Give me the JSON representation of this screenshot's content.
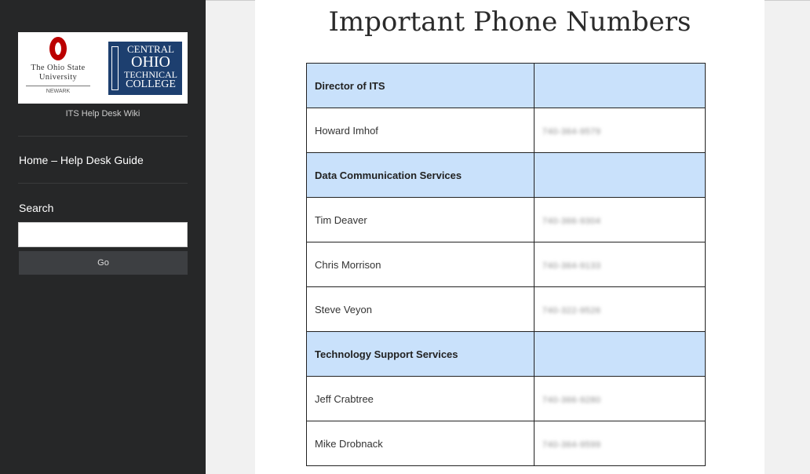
{
  "sidebar": {
    "logo": {
      "osu_name": "The Ohio State University",
      "osu_campus": "NEWARK",
      "cotc_lines": [
        "CENTRAL",
        "OHIO",
        "TECHNICAL",
        "COLLEGE"
      ],
      "osu_color": "#bb0000",
      "cotc_color": "#1d3f6f"
    },
    "site_description": "ITS Help Desk Wiki",
    "nav_home": "Home – Help Desk Guide",
    "search": {
      "title": "Search",
      "input_value": "",
      "button_label": "Go"
    }
  },
  "main": {
    "title": "Important Phone Numbers",
    "header_bg": "#c9e1fb",
    "rows": [
      {
        "type": "header",
        "name": "Director of ITS",
        "phone": ""
      },
      {
        "type": "entry",
        "name": "Howard Imhof",
        "phone": "740-364-9579"
      },
      {
        "type": "header",
        "name": "Data Communication Services",
        "phone": ""
      },
      {
        "type": "entry",
        "name": "Tim Deaver",
        "phone": "740-366-9304"
      },
      {
        "type": "entry",
        "name": "Chris Morrison",
        "phone": "740-364-9133"
      },
      {
        "type": "entry",
        "name": "Steve Veyon",
        "phone": "740-322-9526"
      },
      {
        "type": "header",
        "name": "Technology Support Services",
        "phone": ""
      },
      {
        "type": "entry",
        "name": "Jeff Crabtree",
        "phone": "740-366-9280"
      },
      {
        "type": "entry",
        "name": "Mike Drobnack",
        "phone": "740-364-9599"
      }
    ]
  }
}
